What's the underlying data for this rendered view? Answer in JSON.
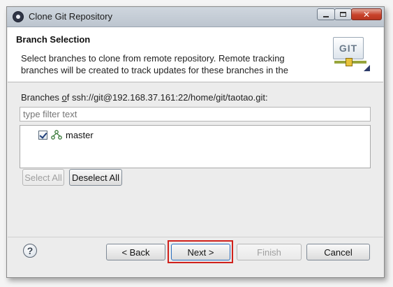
{
  "window": {
    "title": "Clone Git Repository",
    "close_glyph": "✕"
  },
  "header": {
    "title": "Branch Selection",
    "description_line1": "Select branches to clone from remote repository. Remote tracking",
    "description_line2": "branches will be created to track updates for these branches in the",
    "banner_text": "GIT"
  },
  "branches": {
    "label_mnemonic": "o",
    "label_prefix": "Branches ",
    "label_suffix": "f ssh://git@192.168.37.161:22/home/git/taotao.git:",
    "filter_placeholder": "type filter text",
    "items": [
      {
        "name": "master",
        "checked": true
      }
    ],
    "select_all_label": "Select All",
    "deselect_all_label": "Deselect All"
  },
  "footer": {
    "help_glyph": "?",
    "back_label": "< Back",
    "next_label": "Next >",
    "finish_label": "Finish",
    "cancel_label": "Cancel"
  },
  "colors": {
    "highlight": "#d0211c",
    "close_button": "#c8422b",
    "default_button_border": "#2a6fbf"
  }
}
